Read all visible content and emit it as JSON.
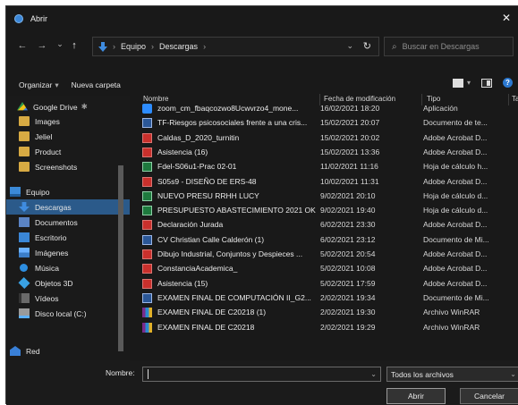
{
  "window": {
    "title": "Abrir",
    "close_glyph": "✕"
  },
  "nav": {
    "back_glyph": "←",
    "forward_glyph": "→",
    "recent_glyph": "⌄",
    "up_glyph": "↑",
    "breadcrumb": [
      "Equipo",
      "Descargas"
    ],
    "crumb_sep": "›",
    "dropdown_glyph": "⌄",
    "refresh_glyph": "↻",
    "search_placeholder": "Buscar en Descargas",
    "search_glyph": "⌕"
  },
  "toolbar": {
    "organize_label": "Organizar",
    "organize_caret": "▾",
    "new_folder_label": "Nueva carpeta",
    "help_glyph": "?"
  },
  "sidebar": {
    "items": [
      {
        "label": "Google Drive",
        "icon": "google-drive-icon",
        "pin": "✱",
        "selected": false
      },
      {
        "label": "Images",
        "icon": "folder-icon",
        "selected": false
      },
      {
        "label": "Jeliel",
        "icon": "folder-icon",
        "selected": false
      },
      {
        "label": "Product",
        "icon": "folder-icon",
        "selected": false
      },
      {
        "label": "Screenshots",
        "icon": "folder-icon",
        "selected": false
      },
      {
        "label": "Equipo",
        "icon": "computer-icon",
        "selected": false
      },
      {
        "label": "Descargas",
        "icon": "downloads-icon",
        "selected": true
      },
      {
        "label": "Documentos",
        "icon": "documents-icon",
        "selected": false
      },
      {
        "label": "Escritorio",
        "icon": "desktop-icon",
        "selected": false
      },
      {
        "label": "Imágenes",
        "icon": "pictures-icon",
        "selected": false
      },
      {
        "label": "Música",
        "icon": "music-icon",
        "selected": false
      },
      {
        "label": "Objetos 3D",
        "icon": "objects-3d-icon",
        "selected": false
      },
      {
        "label": "Vídeos",
        "icon": "videos-icon",
        "selected": false
      },
      {
        "label": "Disco local (C:)",
        "icon": "disk-icon",
        "selected": false
      },
      {
        "label": "Red",
        "icon": "network-icon",
        "selected": false
      }
    ]
  },
  "files": {
    "columns": {
      "name": "Nombre",
      "date": "Fecha de modificación",
      "type": "Tipo",
      "size": "Ta"
    },
    "rows": [
      {
        "name": "zoom_cm_fbaqcozwo8Ucwvrzo4_mone...",
        "date": "16/02/2021 18:20",
        "type": "Aplicación",
        "icon": "app"
      },
      {
        "name": "TF-Riesgos psicosociales frente a una cris...",
        "date": "15/02/2021 20:07",
        "type": "Documento de te...",
        "icon": "doc"
      },
      {
        "name": "Caldas_D_2020_turnitin",
        "date": "15/02/2021 20:02",
        "type": "Adobe Acrobat D...",
        "icon": "pdf"
      },
      {
        "name": "Asistencia (16)",
        "date": "15/02/2021 13:36",
        "type": "Adobe Acrobat D...",
        "icon": "pdf"
      },
      {
        "name": "Fdel-S06u1-Prac 02-01",
        "date": "11/02/2021 11:16",
        "type": "Hoja de cálculo h...",
        "icon": "xls"
      },
      {
        "name": "S05s9 - DISEÑO DE ERS-48",
        "date": "10/02/2021 11:31",
        "type": "Adobe Acrobat D...",
        "icon": "pdf"
      },
      {
        "name": "NUEVO PRESU RRHH LUCY",
        "date": "9/02/2021 20:10",
        "type": "Hoja de cálculo d...",
        "icon": "xls"
      },
      {
        "name": "PRESUPUESTO ABASTECIMIENTO 2021 OK",
        "date": "9/02/2021 19:40",
        "type": "Hoja de cálculo d...",
        "icon": "xls"
      },
      {
        "name": "Declaración Jurada",
        "date": "6/02/2021 23:30",
        "type": "Adobe Acrobat D...",
        "icon": "pdf"
      },
      {
        "name": "CV Christian Calle Calderón (1)",
        "date": "6/02/2021 23:12",
        "type": "Documento de Mi...",
        "icon": "doc"
      },
      {
        "name": "Dibujo Industrial, Conjuntos y Despieces ...",
        "date": "5/02/2021 20:54",
        "type": "Adobe Acrobat D...",
        "icon": "pdf"
      },
      {
        "name": "ConstanciaAcademica_",
        "date": "5/02/2021 10:08",
        "type": "Adobe Acrobat D...",
        "icon": "pdf"
      },
      {
        "name": "Asistencia (15)",
        "date": "5/02/2021 17:59",
        "type": "Adobe Acrobat D...",
        "icon": "pdf"
      },
      {
        "name": "EXAMEN FINAL DE COMPUTACIÓN II_G2...",
        "date": "2/02/2021 19:34",
        "type": "Documento de Mi...",
        "icon": "doc"
      },
      {
        "name": "EXAMEN FINAL DE C20218 (1)",
        "date": "2/02/2021 19:30",
        "type": "Archivo WinRAR",
        "icon": "rar"
      },
      {
        "name": "EXAMEN FINAL DE C20218",
        "date": "2/02/2021 19:29",
        "type": "Archivo WinRAR",
        "icon": "rar"
      }
    ]
  },
  "footer": {
    "name_label": "Nombre:",
    "name_value": "",
    "name_caret": "⌄",
    "filter_value": "Todos los archivos",
    "filter_caret": "⌄",
    "open_label": "Abrir",
    "cancel_label": "Cancelar"
  }
}
